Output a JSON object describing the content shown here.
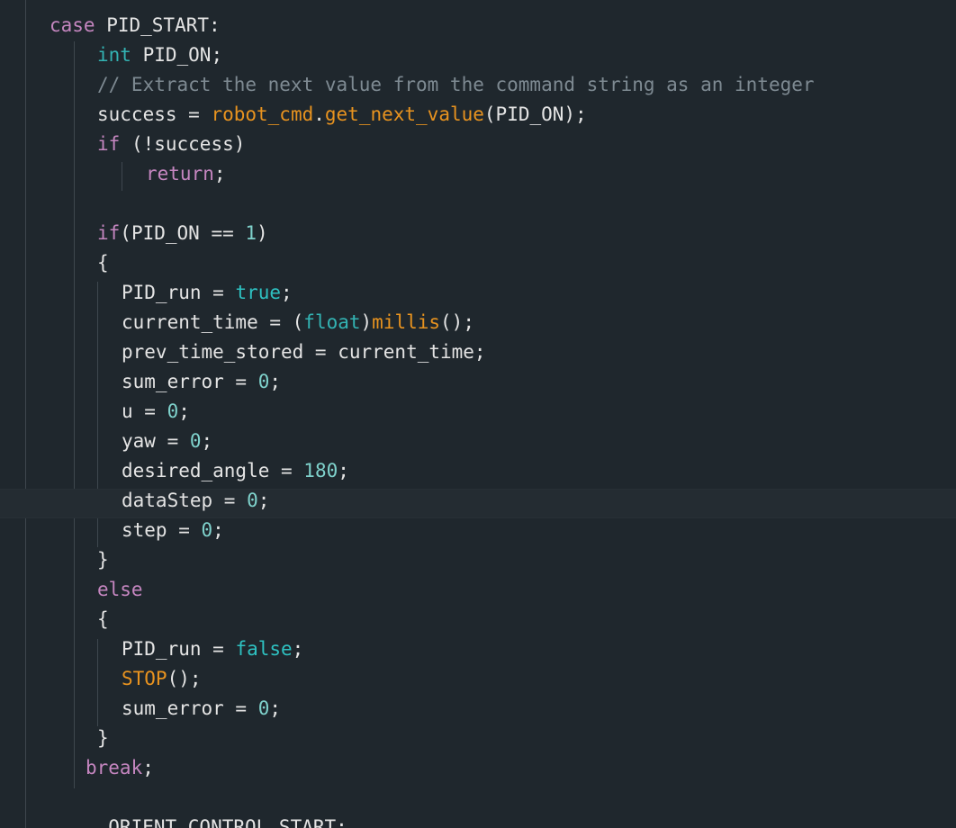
{
  "editor": {
    "language": "C++",
    "colors": {
      "background": "#1f272d",
      "keyword": "#c586c0",
      "type": "#33b3b3",
      "function": "#e8931f",
      "comment": "#7e8a92",
      "number": "#7fd2cc",
      "boolean": "#2ec1c1",
      "text": "#e4e4e4"
    },
    "lines": [
      {
        "indent": 55,
        "tokens": [
          {
            "t": "case",
            "c": "kw"
          },
          {
            "t": " PID_START:",
            "c": "pu"
          }
        ]
      },
      {
        "indent": 108,
        "tokens": [
          {
            "t": "int",
            "c": "ty"
          },
          {
            "t": " PID_ON;",
            "c": "pu"
          }
        ]
      },
      {
        "indent": 108,
        "tokens": [
          {
            "t": "// Extract the next value from the command string as an integer",
            "c": "cm"
          }
        ]
      },
      {
        "indent": 108,
        "tokens": [
          {
            "t": "success = ",
            "c": "pu"
          },
          {
            "t": "robot_cmd",
            "c": "fn"
          },
          {
            "t": ".",
            "c": "pu"
          },
          {
            "t": "get_next_value",
            "c": "fn"
          },
          {
            "t": "(PID_ON);",
            "c": "pu"
          }
        ]
      },
      {
        "indent": 108,
        "tokens": [
          {
            "t": "if",
            "c": "kw"
          },
          {
            "t": " (!success)",
            "c": "pu"
          }
        ]
      },
      {
        "indent": 162,
        "tokens": [
          {
            "t": "return",
            "c": "kw"
          },
          {
            "t": ";",
            "c": "pu"
          }
        ]
      },
      {
        "indent": 108,
        "tokens": []
      },
      {
        "indent": 108,
        "tokens": [
          {
            "t": "if",
            "c": "kw"
          },
          {
            "t": "(PID_ON == ",
            "c": "pu"
          },
          {
            "t": "1",
            "c": "nu"
          },
          {
            "t": ")",
            "c": "pu"
          }
        ]
      },
      {
        "indent": 108,
        "tokens": [
          {
            "t": "{",
            "c": "pu"
          }
        ]
      },
      {
        "indent": 135,
        "tokens": [
          {
            "t": "PID_run = ",
            "c": "pu"
          },
          {
            "t": "true",
            "c": "bo"
          },
          {
            "t": ";",
            "c": "pu"
          }
        ]
      },
      {
        "indent": 135,
        "tokens": [
          {
            "t": "current_time = (",
            "c": "pu"
          },
          {
            "t": "float",
            "c": "ty"
          },
          {
            "t": ")",
            "c": "pu"
          },
          {
            "t": "millis",
            "c": "fn"
          },
          {
            "t": "();",
            "c": "pu"
          }
        ]
      },
      {
        "indent": 135,
        "tokens": [
          {
            "t": "prev_time_stored = current_time;",
            "c": "pu"
          }
        ]
      },
      {
        "indent": 135,
        "tokens": [
          {
            "t": "sum_error = ",
            "c": "pu"
          },
          {
            "t": "0",
            "c": "nu"
          },
          {
            "t": ";",
            "c": "pu"
          }
        ]
      },
      {
        "indent": 135,
        "tokens": [
          {
            "t": "u = ",
            "c": "pu"
          },
          {
            "t": "0",
            "c": "nu"
          },
          {
            "t": ";",
            "c": "pu"
          }
        ]
      },
      {
        "indent": 135,
        "tokens": [
          {
            "t": "yaw = ",
            "c": "pu"
          },
          {
            "t": "0",
            "c": "nu"
          },
          {
            "t": ";",
            "c": "pu"
          }
        ]
      },
      {
        "indent": 135,
        "tokens": [
          {
            "t": "desired_angle = ",
            "c": "pu"
          },
          {
            "t": "180",
            "c": "nu"
          },
          {
            "t": ";",
            "c": "pu"
          }
        ]
      },
      {
        "indent": 135,
        "tokens": [
          {
            "t": "dataStep = ",
            "c": "pu"
          },
          {
            "t": "0",
            "c": "nu"
          },
          {
            "t": ";",
            "c": "pu"
          }
        ]
      },
      {
        "indent": 135,
        "tokens": [
          {
            "t": "step = ",
            "c": "pu"
          },
          {
            "t": "0",
            "c": "nu"
          },
          {
            "t": ";",
            "c": "pu"
          }
        ]
      },
      {
        "indent": 108,
        "tokens": [
          {
            "t": "}",
            "c": "pu"
          }
        ]
      },
      {
        "indent": 108,
        "tokens": [
          {
            "t": "else",
            "c": "kw"
          }
        ]
      },
      {
        "indent": 108,
        "tokens": [
          {
            "t": "{",
            "c": "pu"
          }
        ]
      },
      {
        "indent": 135,
        "tokens": [
          {
            "t": "PID_run = ",
            "c": "pu"
          },
          {
            "t": "false",
            "c": "bo"
          },
          {
            "t": ";",
            "c": "pu"
          }
        ]
      },
      {
        "indent": 135,
        "tokens": [
          {
            "t": "STOP",
            "c": "fn"
          },
          {
            "t": "();",
            "c": "pu"
          }
        ]
      },
      {
        "indent": 135,
        "tokens": [
          {
            "t": "sum_error = ",
            "c": "pu"
          },
          {
            "t": "0",
            "c": "nu"
          },
          {
            "t": ";",
            "c": "pu"
          }
        ]
      },
      {
        "indent": 108,
        "tokens": [
          {
            "t": "}",
            "c": "pu"
          }
        ]
      },
      {
        "indent": 95,
        "tokens": [
          {
            "t": "break",
            "c": "kw"
          },
          {
            "t": ";",
            "c": "pu"
          }
        ]
      },
      {
        "indent": 95,
        "tokens": []
      },
      {
        "indent": 95,
        "tokens": [
          {
            "t": "  ORIENT_CONTROL_START:",
            "c": "pu"
          }
        ]
      }
    ]
  }
}
